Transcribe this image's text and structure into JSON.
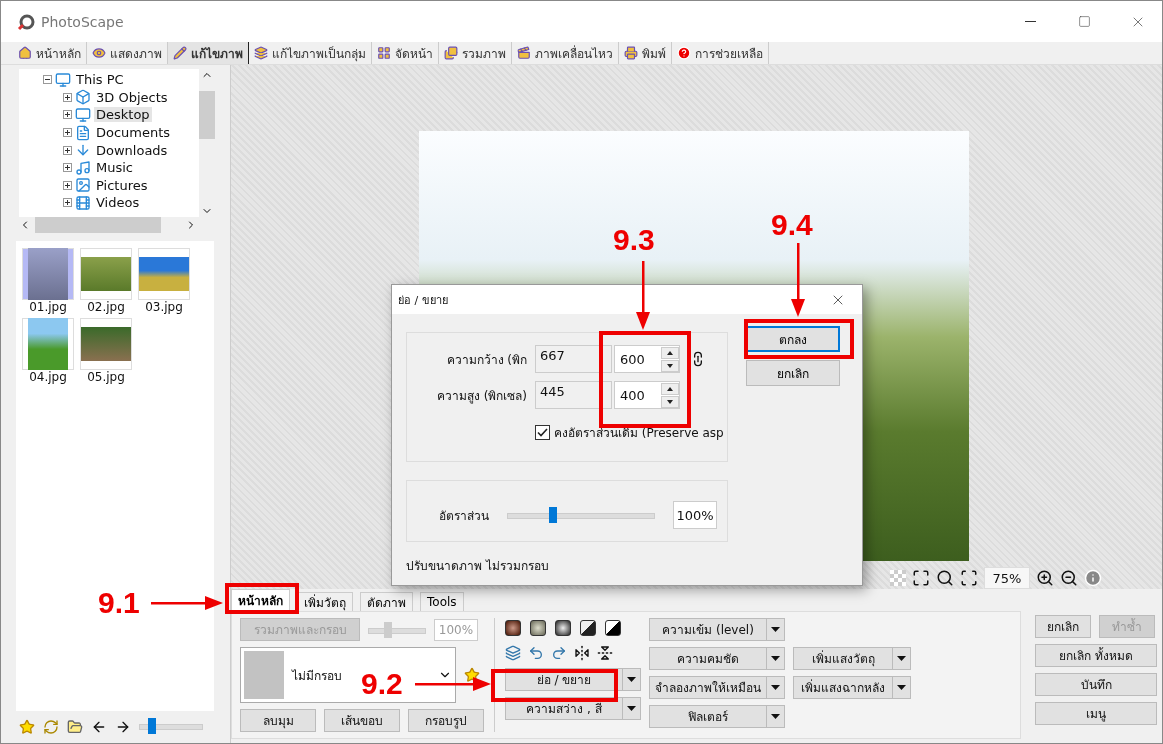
{
  "window": {
    "title": "PhotoScape"
  },
  "tabs": [
    {
      "label": "หน้าหลัก",
      "selected": false
    },
    {
      "label": "แสดงภาพ",
      "selected": false
    },
    {
      "label": "แก้ไขภาพ",
      "selected": true
    },
    {
      "label": "แก้ไขภาพเป็นกลุ่ม",
      "selected": false
    },
    {
      "label": "จัดหน้า",
      "selected": false
    },
    {
      "label": "รวมภาพ",
      "selected": false
    },
    {
      "label": "ภาพเคลื่อนไหว",
      "selected": false
    },
    {
      "label": "พิมพ์",
      "selected": false
    },
    {
      "label": "การช่วยเหลือ",
      "selected": false
    }
  ],
  "folder_tree": [
    {
      "label": "This PC",
      "expanded": true,
      "selected": false,
      "children": [
        {
          "label": "3D Objects",
          "expanded": false,
          "selected": false
        },
        {
          "label": "Desktop",
          "expanded": false,
          "selected": true
        },
        {
          "label": "Documents",
          "expanded": false,
          "selected": false
        },
        {
          "label": "Downloads",
          "expanded": false,
          "selected": false
        },
        {
          "label": "Music",
          "expanded": false,
          "selected": false
        },
        {
          "label": "Pictures",
          "expanded": false,
          "selected": false
        },
        {
          "label": "Videos",
          "expanded": false,
          "selected": false
        }
      ]
    }
  ],
  "thumbnails": [
    {
      "name": "01.jpg",
      "selected": true
    },
    {
      "name": "02.jpg",
      "selected": false
    },
    {
      "name": "03.jpg",
      "selected": false
    },
    {
      "name": "04.jpg",
      "selected": false
    },
    {
      "name": "05.jpg",
      "selected": false
    }
  ],
  "file_slider": {
    "level": 0.2
  },
  "zoom": "75%",
  "dialog": {
    "title": "ย่อ / ขยาย",
    "width_label": "ความกว้าง (พิก",
    "width_original": "667",
    "width_value": "600",
    "height_label": "ความสูง (พิกเซล)",
    "height_original": "445",
    "height_value": "400",
    "preserve": {
      "label": "คงอัตราส่วนเดิม (Preserve asp",
      "checked": true
    },
    "ratio_label": "อัตราส่วน",
    "ratio": {
      "level": 0.31
    },
    "ratio_value": "100%",
    "ok": "ตกลง",
    "cancel": "ยกเลิก",
    "footer": "ปรับขนาดภาพ ไม่รวมกรอบ"
  },
  "editor_tabs": [
    {
      "label": "หน้าหลัก",
      "selected": true
    },
    {
      "label": "เพิ่มวัตถุ",
      "selected": false
    },
    {
      "label": "ตัดภาพ",
      "selected": false
    },
    {
      "label": "Tools",
      "selected": false
    }
  ],
  "frame_panel": {
    "combine": {
      "label": "รวมภาพและกรอบ",
      "disabled": true
    },
    "scale": {
      "level": 0.35
    },
    "scale_value": "100%",
    "frame": "ไม่มีกรอบ",
    "buttons": [
      "ลบมุม",
      "เส้นขอบ",
      "กรอบรูป"
    ]
  },
  "tool_buttons": [
    "ย่อ / ขยาย",
    "ความสว่าง , สี"
  ],
  "filter_buttons": [
    "ความเข้ม (level)",
    "ความคมชัด",
    "จำลองภาพให้เหมือน",
    "ฟิลเตอร์"
  ],
  "light_buttons": [
    "เพิ่มแสงวัตถุ",
    "เพิ่มแสงฉากหลัง"
  ],
  "history": {
    "undo": {
      "label": "ยกเลิก",
      "disabled": false
    },
    "redo": {
      "label": "ทำซ้ำ",
      "disabled": true
    },
    "undo_all": "ยกเลิก ทั้งหมด",
    "save": "บันทึก",
    "menu": "เมนู"
  },
  "annotations": [
    {
      "label": "9.1"
    },
    {
      "label": "9.2"
    },
    {
      "label": "9.3"
    },
    {
      "label": "9.4"
    }
  ]
}
